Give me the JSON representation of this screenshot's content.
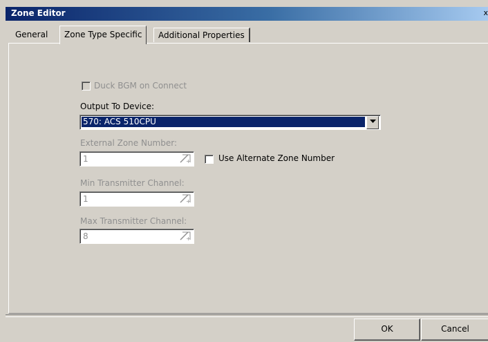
{
  "window": {
    "title": "Zone Editor",
    "close_glyph": "x"
  },
  "tabs": [
    {
      "label": "General",
      "selected": false
    },
    {
      "label": "Zone Type Specific",
      "selected": true
    },
    {
      "label": "Additional Properties",
      "selected": false
    }
  ],
  "form": {
    "duck_bgm": {
      "label": "Duck BGM on Connect",
      "checked": false,
      "enabled": false
    },
    "output_device": {
      "label": "Output To Device:",
      "value": "570: ACS 510CPU"
    },
    "external_zone": {
      "label": "External Zone Number:",
      "value": "1",
      "enabled": false
    },
    "use_alternate": {
      "label": "Use Alternate Zone Number",
      "checked": false
    },
    "min_channel": {
      "label": "Min Transmitter Channel:",
      "value": "1",
      "enabled": false
    },
    "max_channel": {
      "label": "Max Transmitter Channel:",
      "value": "8",
      "enabled": false
    }
  },
  "buttons": {
    "ok": "OK",
    "cancel": "Cancel"
  },
  "icons": {
    "dropdown": "chevron-down-icon",
    "spinner": "spin-edit-icon"
  }
}
